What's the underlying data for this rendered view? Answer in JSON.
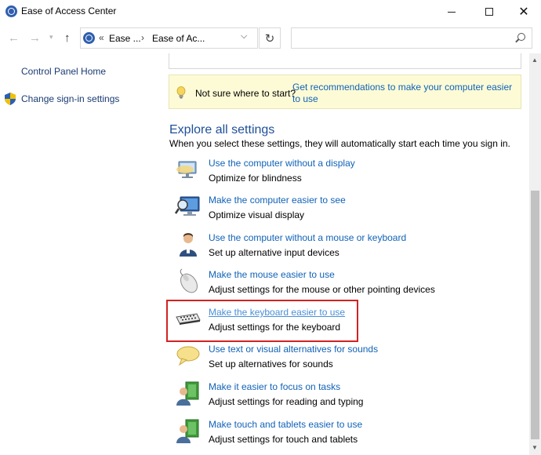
{
  "window": {
    "title": "Ease of Access Center",
    "minimize_glyph": "—",
    "close_glyph": "✕"
  },
  "nav": {
    "back_glyph": "←",
    "forward_glyph": "→",
    "recent_glyph": "⌄",
    "up_glyph": "↑",
    "address_chevron": "«",
    "address_segments": [
      "Ease ...",
      "Ease of Ac..."
    ],
    "address_sep": "›",
    "address_dropdown_glyph": "⌄",
    "refresh_glyph": "↻",
    "search_placeholder": ""
  },
  "left_panel": {
    "home_link": "Control Panel Home",
    "signin_link": "Change sign-in settings"
  },
  "tip": {
    "text": "Not sure where to start?",
    "link": "Get recommendations to make your computer easier to use"
  },
  "explore": {
    "title": "Explore all settings",
    "description": "When you select these settings, they will automatically start each time you sign in."
  },
  "settings": [
    {
      "link": "Use the computer without a display",
      "desc": "Optimize for blindness",
      "icon": "display-narrator-icon"
    },
    {
      "link": "Make the computer easier to see",
      "desc": "Optimize visual display",
      "icon": "magnifier-monitor-icon"
    },
    {
      "link": "Use the computer without a mouse or keyboard",
      "desc": "Set up alternative input devices",
      "icon": "person-icon"
    },
    {
      "link": "Make the mouse easier to use",
      "desc": "Adjust settings for the mouse or other pointing devices",
      "icon": "mouse-icon"
    },
    {
      "link": "Make the keyboard easier to use",
      "desc": "Adjust settings for the keyboard",
      "icon": "keyboard-icon"
    },
    {
      "link": "Use text or visual alternatives for sounds",
      "desc": "Set up alternatives for sounds",
      "icon": "speech-bubble-icon"
    },
    {
      "link": "Make it easier to focus on tasks",
      "desc": "Adjust settings for reading and typing",
      "icon": "focus-person-icon"
    },
    {
      "link": "Make touch and tablets easier to use",
      "desc": "Adjust settings for touch and tablets",
      "icon": "touch-person-icon"
    }
  ],
  "scrollbar": {
    "up_glyph": "▲",
    "down_glyph": "▼"
  },
  "colors": {
    "link": "#1062b8",
    "highlight": "#d32222",
    "tip_background": "#fdfbd6"
  }
}
